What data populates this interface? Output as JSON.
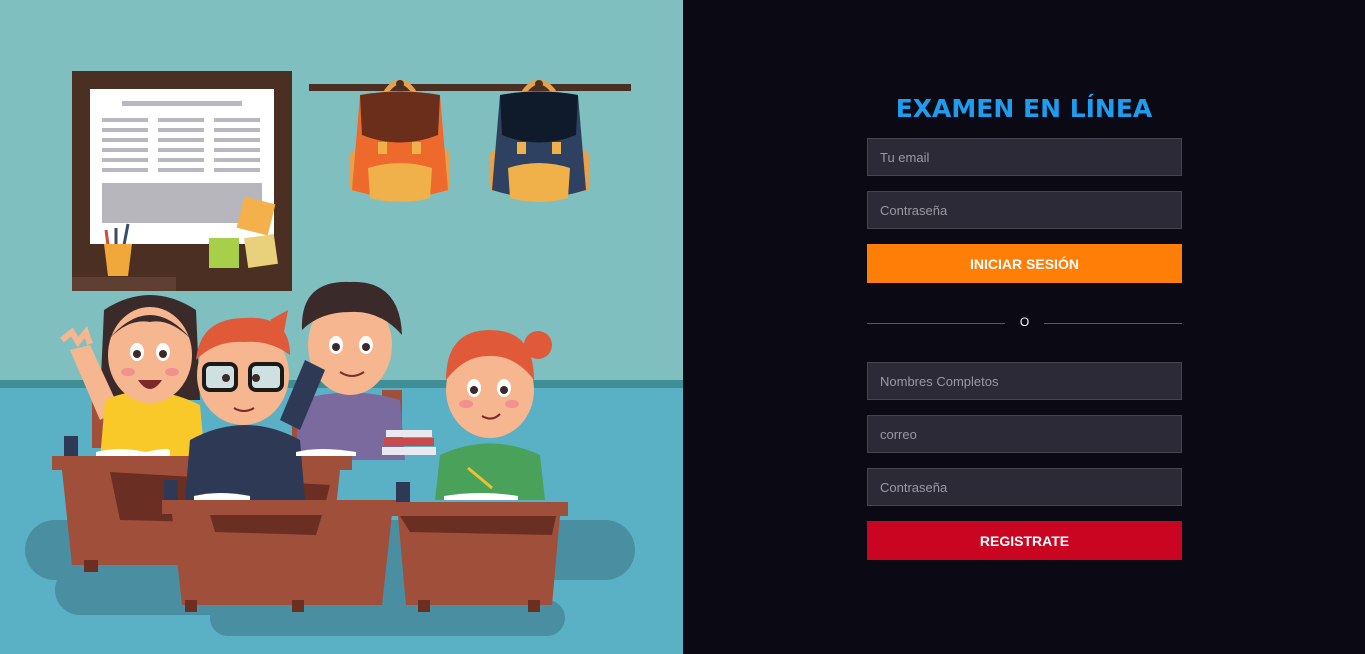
{
  "title": "EXAMEN EN LÍNEA",
  "login": {
    "email_placeholder": "Tu email",
    "password_placeholder": "Contraseña",
    "submit_label": "INICIAR SESIÓN"
  },
  "divider_text": "O",
  "register": {
    "name_placeholder": "Nombres Completos",
    "email_placeholder": "correo",
    "password_placeholder": "Contraseña",
    "submit_label": "REGISTRATE"
  },
  "colors": {
    "background": "#0a0914",
    "title": "#1e9df0",
    "login_button": "#ff7e07",
    "register_button": "#c90522",
    "field_background": "#2b2a36"
  },
  "icons": [
    "classroom-illustration"
  ]
}
